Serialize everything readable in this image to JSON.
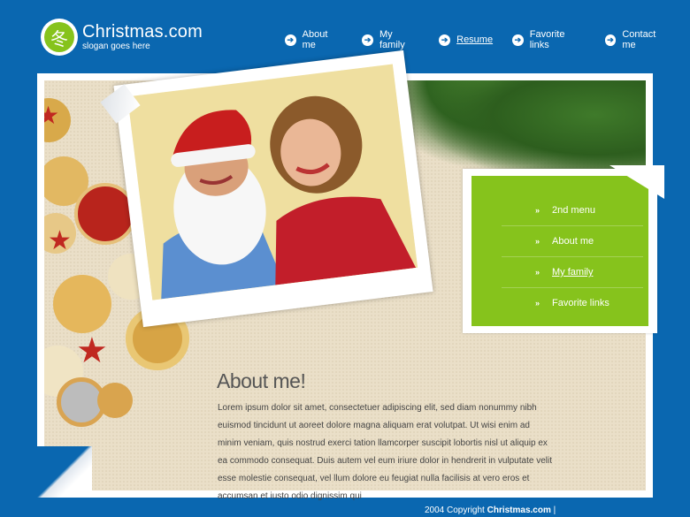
{
  "header": {
    "logo_glyph": "冬",
    "title": "Christmas.com",
    "slogan": "slogan goes here"
  },
  "topnav": [
    {
      "label": "About me",
      "active": false
    },
    {
      "label": "My family",
      "active": false
    },
    {
      "label": "Resume",
      "active": true
    },
    {
      "label": "Favorite links",
      "active": false
    },
    {
      "label": "Contact me",
      "active": false
    }
  ],
  "submenu": [
    {
      "label": "2nd menu",
      "active": false
    },
    {
      "label": "About me",
      "active": false
    },
    {
      "label": "My family",
      "active": true
    },
    {
      "label": "Favorite links",
      "active": false
    }
  ],
  "content": {
    "heading": "About me!",
    "body": "Lorem ipsum dolor sit amet, consectetuer adipiscing elit, sed diam nonummy nibh euismod tincidunt ut aoreet dolore magna aliquam erat volutpat. Ut wisi enim ad minim veniam, quis nostrud exerci tation llamcorper suscipit lobortis nisl ut aliquip ex ea commodo consequat. Duis autem vel eum iriure dolor in hendrerit in vulputate velit esse molestie consequat, vel llum dolore eu feugiat nulla facilisis at vero eros et accumsan et iusto odio dignissim qui"
  },
  "footer": {
    "copyright": "2004 Copyright",
    "site": "Christmas.com",
    "separator": "|"
  },
  "colors": {
    "background": "#0a67b0",
    "accent_green": "#86c31c",
    "paper": "#eadfc8"
  }
}
